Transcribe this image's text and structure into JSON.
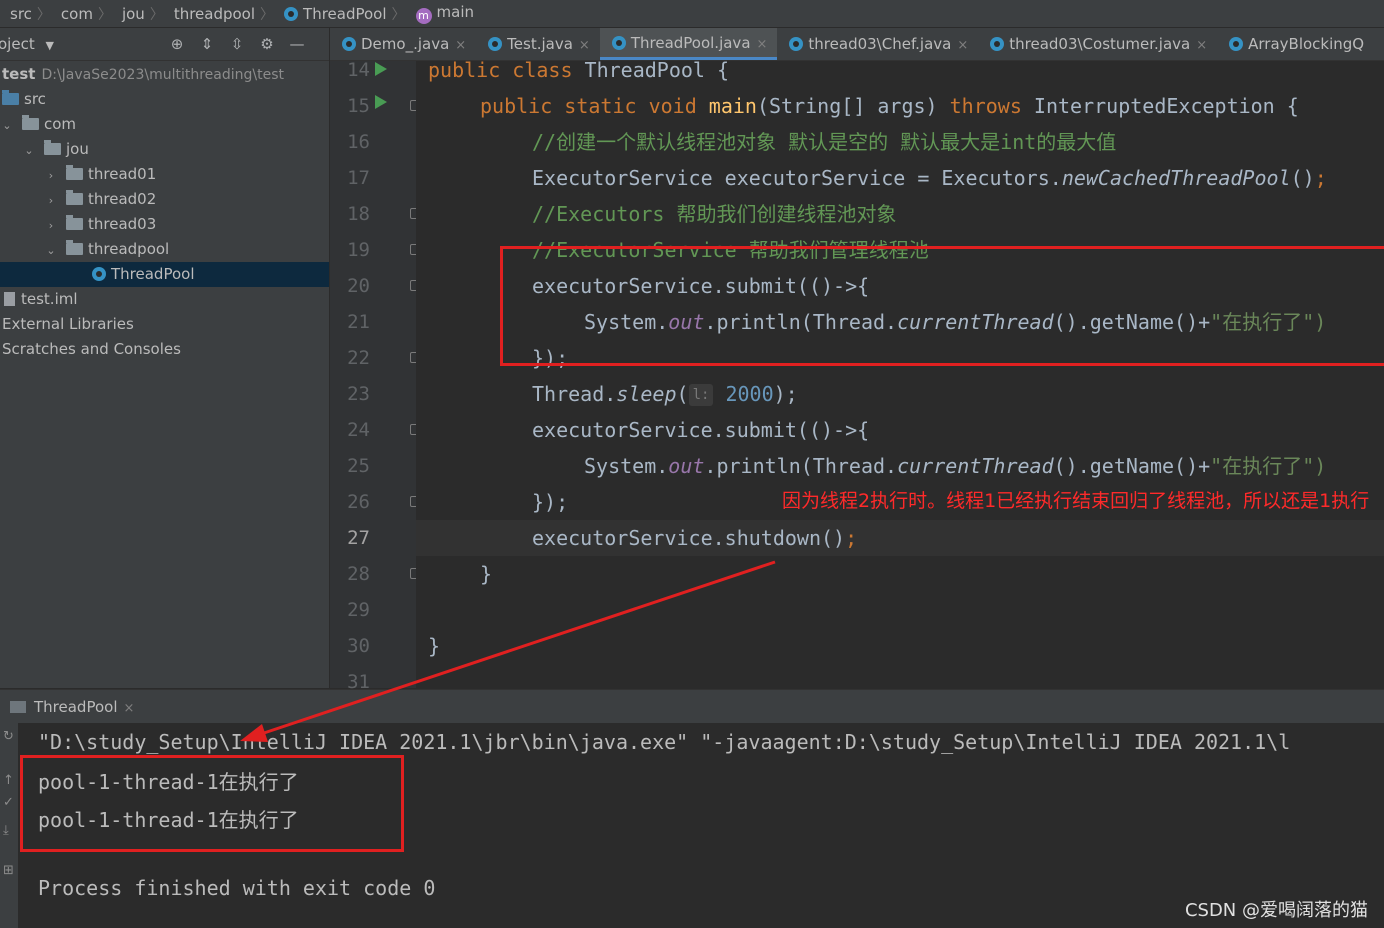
{
  "breadcrumb": [
    "src",
    "com",
    "jou",
    "threadpool",
    "ThreadPool",
    "main"
  ],
  "project": {
    "title": "oject",
    "root_name": "test",
    "root_path": "D:\\JavaSe2023\\multithreading\\test",
    "items": [
      "src",
      "com",
      "jou",
      "thread01",
      "thread02",
      "thread03",
      "threadpool",
      "ThreadPool",
      "test.iml",
      "External Libraries",
      "Scratches and Consoles"
    ]
  },
  "tabs": [
    "Demo_.java",
    "Test.java",
    "ThreadPool.java",
    "thread03\\Chef.java",
    "thread03\\Costumer.java",
    "ArrayBlockingQ"
  ],
  "active_tab": "ThreadPool.java",
  "line_numbers": [
    "14",
    "15",
    "16",
    "17",
    "18",
    "19",
    "20",
    "21",
    "22",
    "23",
    "24",
    "25",
    "26",
    "27",
    "28",
    "29",
    "30",
    "31"
  ],
  "current_line": "27",
  "code": {
    "l14_kw": "public class ",
    "l14_rest": "ThreadPool {",
    "l15_kw": "public static void ",
    "l15_fn": "main",
    "l15_mid": "(String[] args) ",
    "l15_kw2": "throws ",
    "l15_rest": "InterruptedException {",
    "l16_comment": "//创建一个默认线程池对象 默认是空的 默认最大是int的最大值",
    "l17_a": "ExecutorService executorService = Executors.",
    "l17_it": "newCachedThreadPool",
    "l17_b": "()",
    "l17_semi": ";",
    "l18_comment": "//Executors 帮助我们创建线程池对象",
    "l19_comment": "//ExecutorService 帮助我们管理线程池",
    "l20": "executorService.submit(()->{",
    "l21_a": "System.",
    "l21_out": "out",
    "l21_b": ".println(Thread.",
    "l21_it": "currentThread",
    "l21_c": "().getName()+",
    "l21_str": "\"在执行了\")",
    "l22": "});",
    "l23_a": "Thread.",
    "l23_it": "sleep",
    "l23_b": "(",
    "l23_hint": "l:",
    "l23_num": "2000",
    "l23_c": ");",
    "l24": "executorService.submit(()->{",
    "l25_a": "System.",
    "l25_out": "out",
    "l25_b": ".println(Thread.",
    "l25_it": "currentThread",
    "l25_c": "().getName()+",
    "l25_str": "\"在执行了\")",
    "l26": "});",
    "l27": "executorService.shutdown()",
    "l27_semi": ";",
    "l28": "}",
    "l30": "}"
  },
  "annotation": "因为线程2执行时。线程1已经执行结束回归了线程池，所以还是1执行",
  "run": {
    "tab": "ThreadPool",
    "cmd": "\"D:\\study_Setup\\IntelliJ IDEA 2021.1\\jbr\\bin\\java.exe\" \"-javaagent:D:\\study_Setup\\IntelliJ IDEA 2021.1\\l",
    "out1": "pool-1-thread-1在执行了",
    "out2": "pool-1-thread-1在执行了",
    "exit": "Process finished with exit code 0"
  },
  "watermark": "CSDN @爱喝阔落的猫",
  "colors": {
    "accent": "#4a88c7",
    "annotation_red": "#e02020",
    "keyword": "#cc7832",
    "comment": "#629755"
  }
}
